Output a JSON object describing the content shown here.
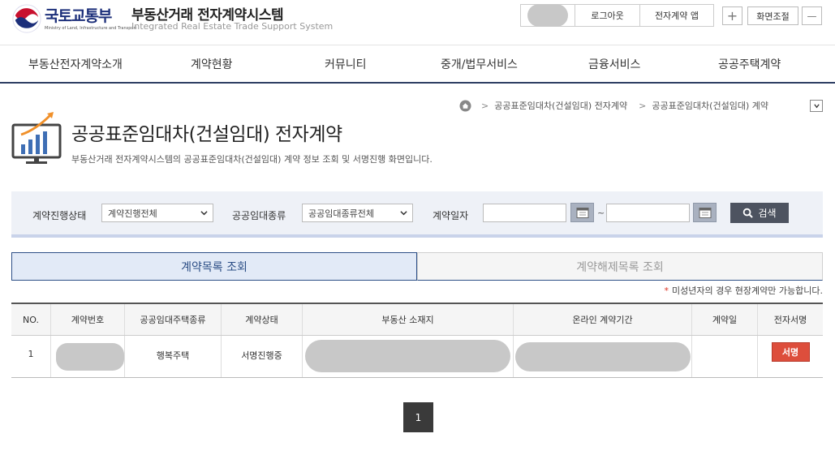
{
  "header": {
    "ministry_name": "국토교통부",
    "ministry_eng": "Ministry of Land, Infrastructure and Transport",
    "site_title": "부동산거래 전자계약시스템",
    "site_subtitle": "Integrated Real Estate Trade Support System",
    "util": {
      "logout": "로그아웃",
      "app": "전자계약 앱"
    },
    "zoom_label": "화면조절",
    "zoom_plus": "+",
    "zoom_minus": "—"
  },
  "nav": {
    "items": [
      "부동산전자계약소개",
      "계약현황",
      "커뮤니티",
      "중개/법무서비스",
      "금융서비스",
      "공공주택계약"
    ]
  },
  "breadcrumb": {
    "items": [
      "공공표준임대차(건설임대) 전자계약",
      "공공표준임대차(건설임대) 계약"
    ],
    "toggle": "⌄"
  },
  "page": {
    "title": "공공표준임대차(건설임대) 전자계약",
    "description": "부동산거래 전자계약시스템의 공공표준임대차(건설임대) 계약 정보 조회 및 서명진행 화면입니다."
  },
  "search": {
    "status_label": "계약진행상태",
    "status_value": "계약진행전체",
    "type_label": "공공임대종류",
    "type_value": "공공임대종류전체",
    "date_label": "계약일자",
    "date_from": "",
    "date_to": "",
    "tilde": "~",
    "button": "검색"
  },
  "tabs": {
    "active": "계약목록 조회",
    "inactive": "계약해제목록 조회"
  },
  "notice": {
    "star": "*",
    "text": "미성년자의 경우 현장계약만 가능합니다."
  },
  "table": {
    "headers": [
      "NO.",
      "계약번호",
      "공공임대주택종류",
      "계약상태",
      "부동산 소재지",
      "온라인 계약기간",
      "계약일",
      "전자서명"
    ],
    "rows": [
      {
        "no": "1",
        "contract_no": "",
        "house_type": "행복주택",
        "status": "서명진행중",
        "address": "",
        "period": "",
        "date": "",
        "sign": "서명"
      }
    ]
  },
  "pagination": {
    "current": "1"
  },
  "colors": {
    "navy": "#1c2f7a",
    "nav_border": "#2d3e63",
    "accent_red": "#dd4e3c",
    "tab_blue": "#2b4d85"
  }
}
